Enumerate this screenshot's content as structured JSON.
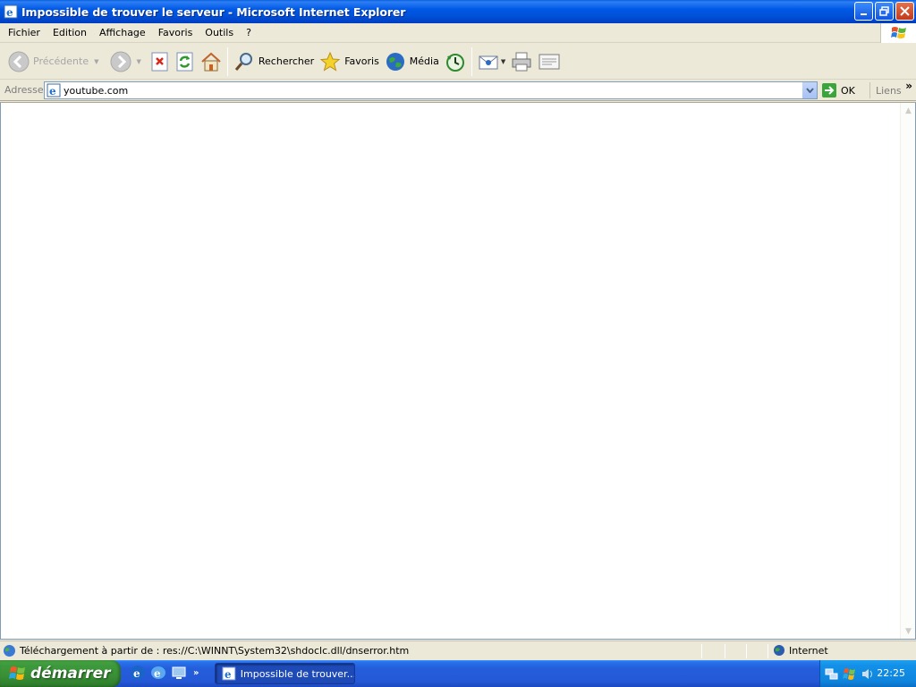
{
  "window": {
    "title": "Impossible de trouver le serveur - Microsoft Internet Explorer"
  },
  "menu": {
    "items": [
      "Fichier",
      "Edition",
      "Affichage",
      "Favoris",
      "Outils",
      "?"
    ]
  },
  "toolbar": {
    "back_label": "Précédente",
    "search_label": "Rechercher",
    "favorites_label": "Favoris",
    "media_label": "Média"
  },
  "address_bar": {
    "label": "Adresse",
    "url": "youtube.com",
    "go_label": "OK",
    "links_label": "Liens"
  },
  "status_bar": {
    "text": "Téléchargement à partir de : res://C:\\WINNT\\System32\\shdoclc.dll/dnserror.htm",
    "zone": "Internet"
  },
  "taskbar": {
    "start_label": "démarrer",
    "task_label": "Impossible de trouver...",
    "clock": "22:25"
  }
}
